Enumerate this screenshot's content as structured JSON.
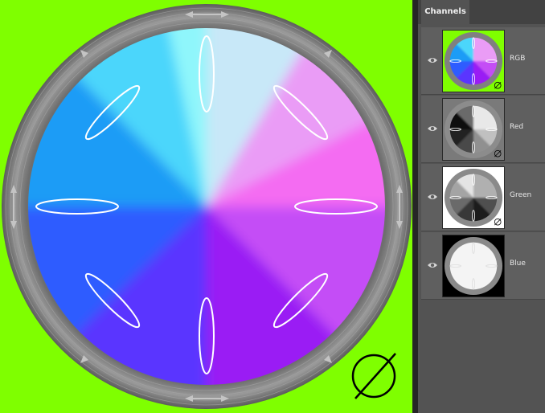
{
  "panel": {
    "tab_label": "Channels",
    "channels": [
      {
        "label": "RGB",
        "visible": true
      },
      {
        "label": "Red",
        "visible": true
      },
      {
        "label": "Green",
        "visible": true
      },
      {
        "label": "Blue",
        "visible": true
      }
    ]
  },
  "colors": {
    "canvas_background": "#7fff00",
    "panel_background": "#535353",
    "ring": "#8a8a8a"
  },
  "icons": {
    "corner_symbol": "null-symbol-icon",
    "visibility": "eye-icon"
  }
}
